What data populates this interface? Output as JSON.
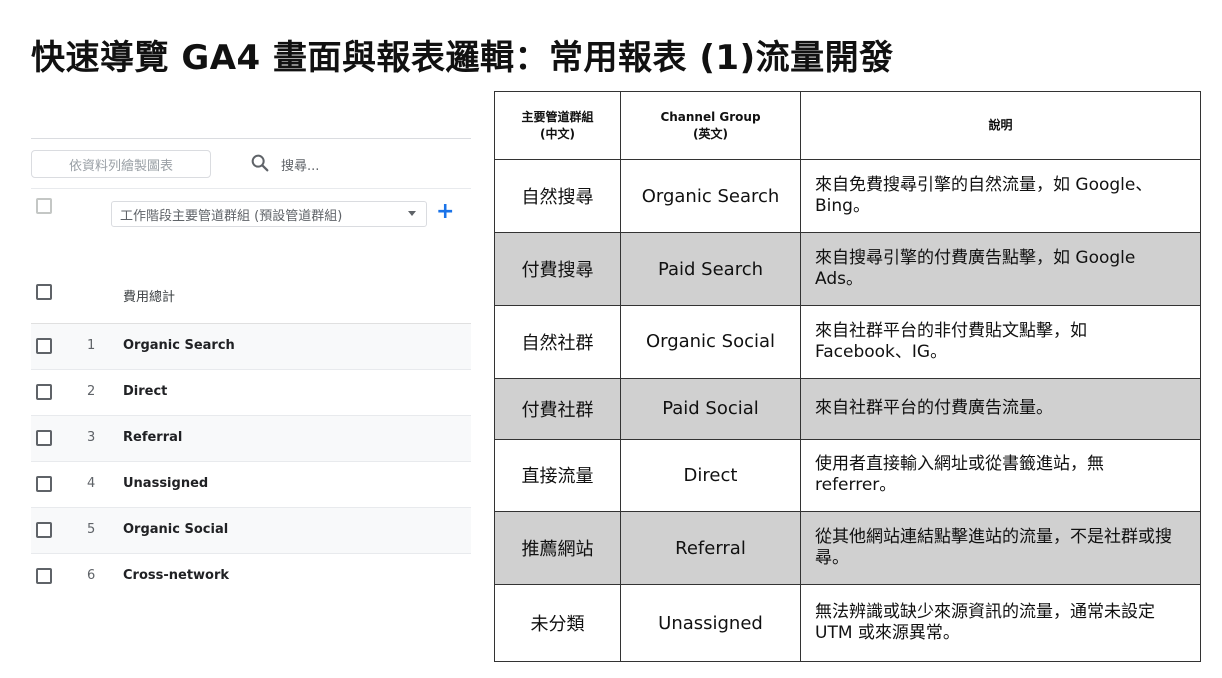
{
  "page": {
    "title": "快速導覽 GA4 畫面與報表邏輯：常用報表 (1)流量開發"
  },
  "ga_panel": {
    "chart_button": "依資料列繪製圖表",
    "search_placeholder": "搜尋...",
    "dimension_select": "工作階段主要管道群組 (預設管道群組)",
    "add_dimension": "+",
    "total_label": "費用總計",
    "rows": [
      {
        "index": "1",
        "label": "Organic Search"
      },
      {
        "index": "2",
        "label": "Direct"
      },
      {
        "index": "3",
        "label": "Referral"
      },
      {
        "index": "4",
        "label": "Unassigned"
      },
      {
        "index": "5",
        "label": "Organic Social"
      },
      {
        "index": "6",
        "label": "Cross-network"
      }
    ]
  },
  "channel_table": {
    "headers": {
      "zh_line1": "主要管道群組",
      "zh_line2": "(中文)",
      "en_line1": "Channel Group",
      "en_line2": "(英文)",
      "desc": "說明"
    },
    "rows": [
      {
        "zh": "自然搜尋",
        "en": "Organic Search",
        "desc": "來自免費搜尋引擎的自然流量，如 Google、Bing。"
      },
      {
        "zh": "付費搜尋",
        "en": "Paid Search",
        "desc": "來自搜尋引擎的付費廣告點擊，如 Google Ads。"
      },
      {
        "zh": "自然社群",
        "en": "Organic Social",
        "desc": "來自社群平台的非付費貼文點擊，如 Facebook、IG。"
      },
      {
        "zh": "付費社群",
        "en": "Paid Social",
        "desc": "來自社群平台的付費廣告流量。"
      },
      {
        "zh": "直接流量",
        "en": "Direct",
        "desc": "使用者直接輸入網址或從書籤進站，無 referrer。"
      },
      {
        "zh": "推薦網站",
        "en": "Referral",
        "desc": "從其他網站連結點擊進站的流量，不是社群或搜尋。"
      },
      {
        "zh": "未分類",
        "en": "Unassigned",
        "desc": "無法辨識或缺少來源資訊的流量，通常未設定 UTM 或來源異常。"
      }
    ]
  }
}
